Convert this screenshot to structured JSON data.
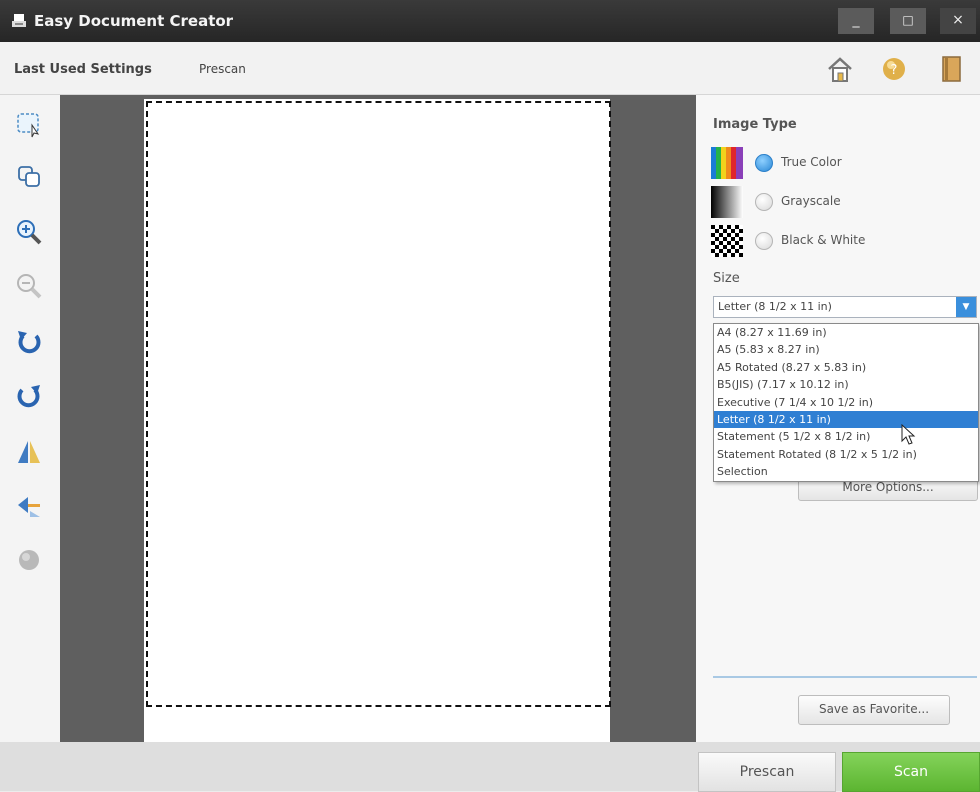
{
  "app": {
    "title": "Easy Document Creator"
  },
  "window_controls": {
    "minimize": "_",
    "maximize": "□",
    "close": "×"
  },
  "menu": {
    "last_used": "Last Used Settings",
    "prescan": "Prescan"
  },
  "toolbar_icons": [
    "select-icon",
    "copy-region-icon",
    "zoom-in-icon",
    "zoom-out-icon",
    "rotate-left-icon",
    "rotate-right-icon",
    "flip-icon",
    "crop-icon",
    "clear-icon"
  ],
  "top_icons": [
    "home-icon",
    "help-icon",
    "book-icon"
  ],
  "panel": {
    "image_type_heading": "Image Type",
    "types": [
      {
        "label": "True Color",
        "selected": true
      },
      {
        "label": "Grayscale",
        "selected": false
      },
      {
        "label": "Black & White",
        "selected": false
      }
    ],
    "size_heading": "Size",
    "size_value": "Letter (8 1/2 x 11 in)",
    "size_options": [
      "A4 (8.27 x 11.69 in)",
      "A5 (5.83 x 8.27 in)",
      "A5 Rotated (8.27 x 5.83 in)",
      "B5(JIS) (7.17 x 10.12 in)",
      "Executive (7 1/4 x 10 1/2 in)",
      "Letter (8 1/2 x 11 in)",
      "Statement (5 1/2 x 8 1/2 in)",
      "Statement Rotated (8 1/2 x 5 1/2 in)",
      "Selection"
    ],
    "selected_option": "Letter (8 1/2 x 11 in)",
    "more_options": "More Options...",
    "save_favorite": "Save as Favorite..."
  },
  "bottom": {
    "prescan": "Prescan",
    "scan": "Scan"
  },
  "colors": {
    "accent_blue": "#2f7fd3",
    "scan_green": "#5cb531",
    "preview_gray": "#5f5f5f",
    "titlebar": "#2b2b2b"
  }
}
